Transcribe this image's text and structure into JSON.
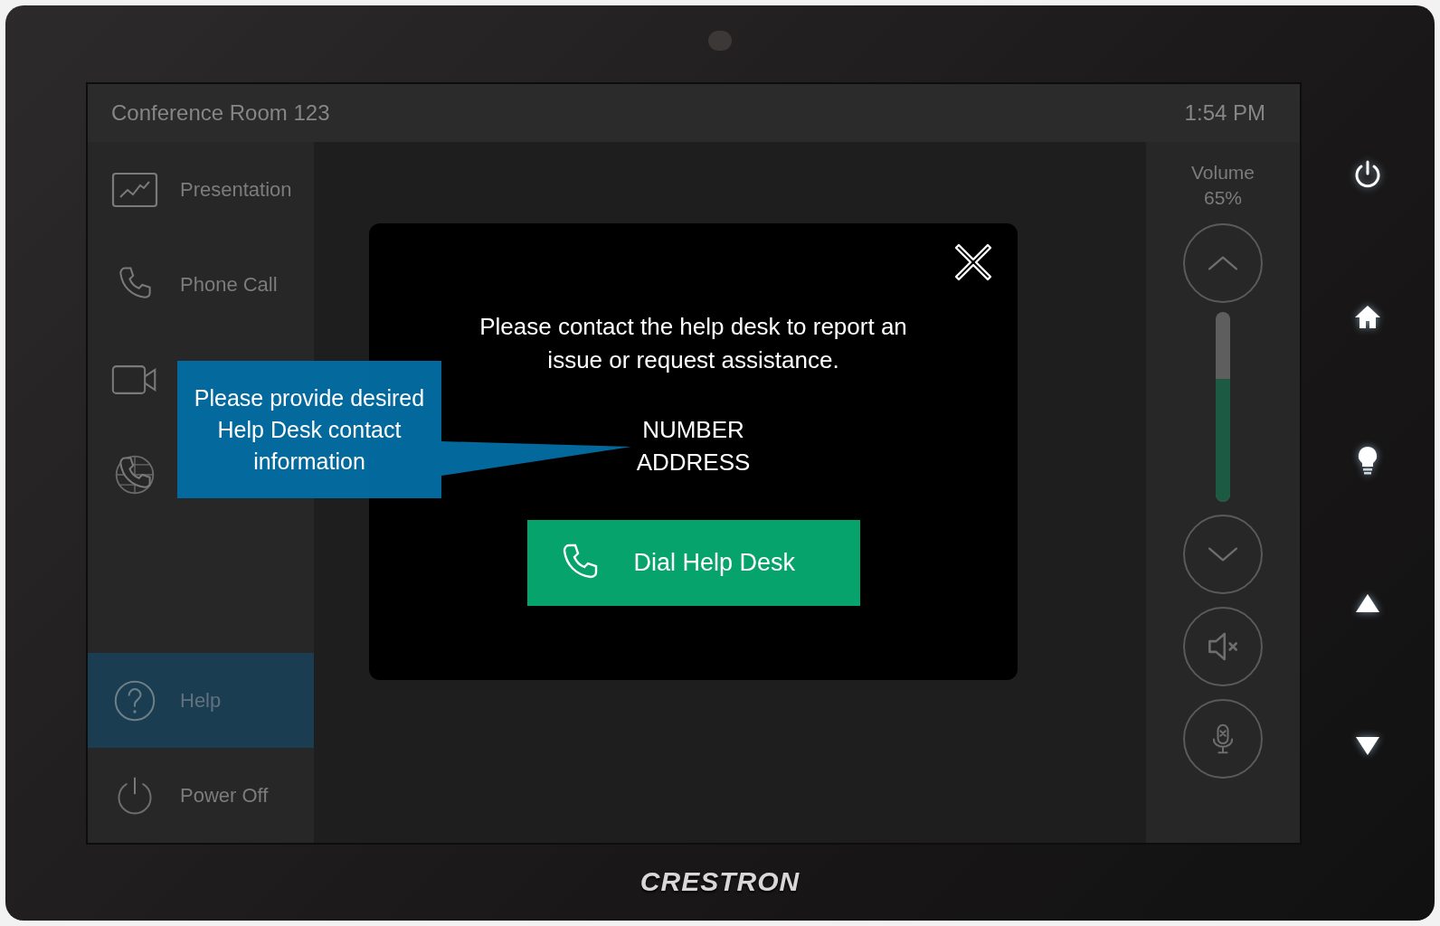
{
  "header": {
    "room": "Conference Room 123",
    "time": "1:54 PM"
  },
  "sidebar": {
    "items": [
      {
        "kind": "presentation",
        "label": "Presentation",
        "selected": false
      },
      {
        "kind": "phone",
        "label": "Phone Call",
        "selected": false
      },
      {
        "kind": "video",
        "selected": false
      },
      {
        "kind": "web",
        "selected": false
      },
      {
        "kind": "help",
        "label": "Help",
        "selected": true
      },
      {
        "kind": "power",
        "label": "Power Off",
        "selected": false
      }
    ]
  },
  "volume": {
    "label": "Volume",
    "reading": "65%",
    "level": 0.65
  },
  "dialog": {
    "message": "Please contact the help desk to report an issue or request assistance.",
    "lines": [
      "NUMBER",
      "ADDRESS"
    ],
    "button": "Dial Help Desk"
  },
  "callout": {
    "text": "Please provide desired Help Desk contact information"
  },
  "device": {
    "brand": "CRESTRON"
  }
}
